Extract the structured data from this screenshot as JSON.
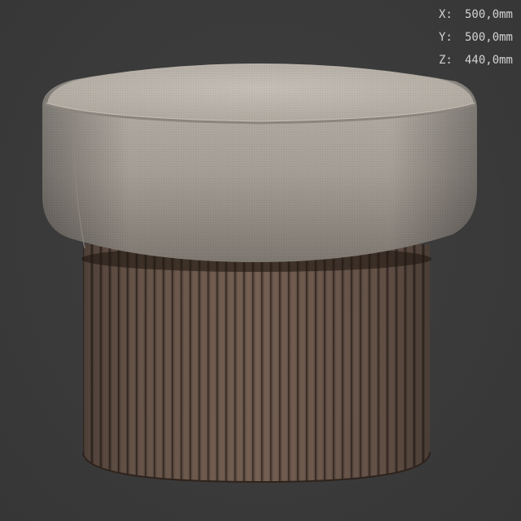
{
  "dimensions": {
    "x": {
      "axis": "X:",
      "value": "500,0mm"
    },
    "y": {
      "axis": "Y:",
      "value": "500,0mm"
    },
    "z": {
      "axis": "Z:",
      "value": "440,0mm"
    }
  },
  "colors": {
    "background": "#3b3b3b",
    "cushion": "#b3aca4",
    "base_wood": "#5a4538",
    "overlay_text": "#d2d2d2"
  }
}
